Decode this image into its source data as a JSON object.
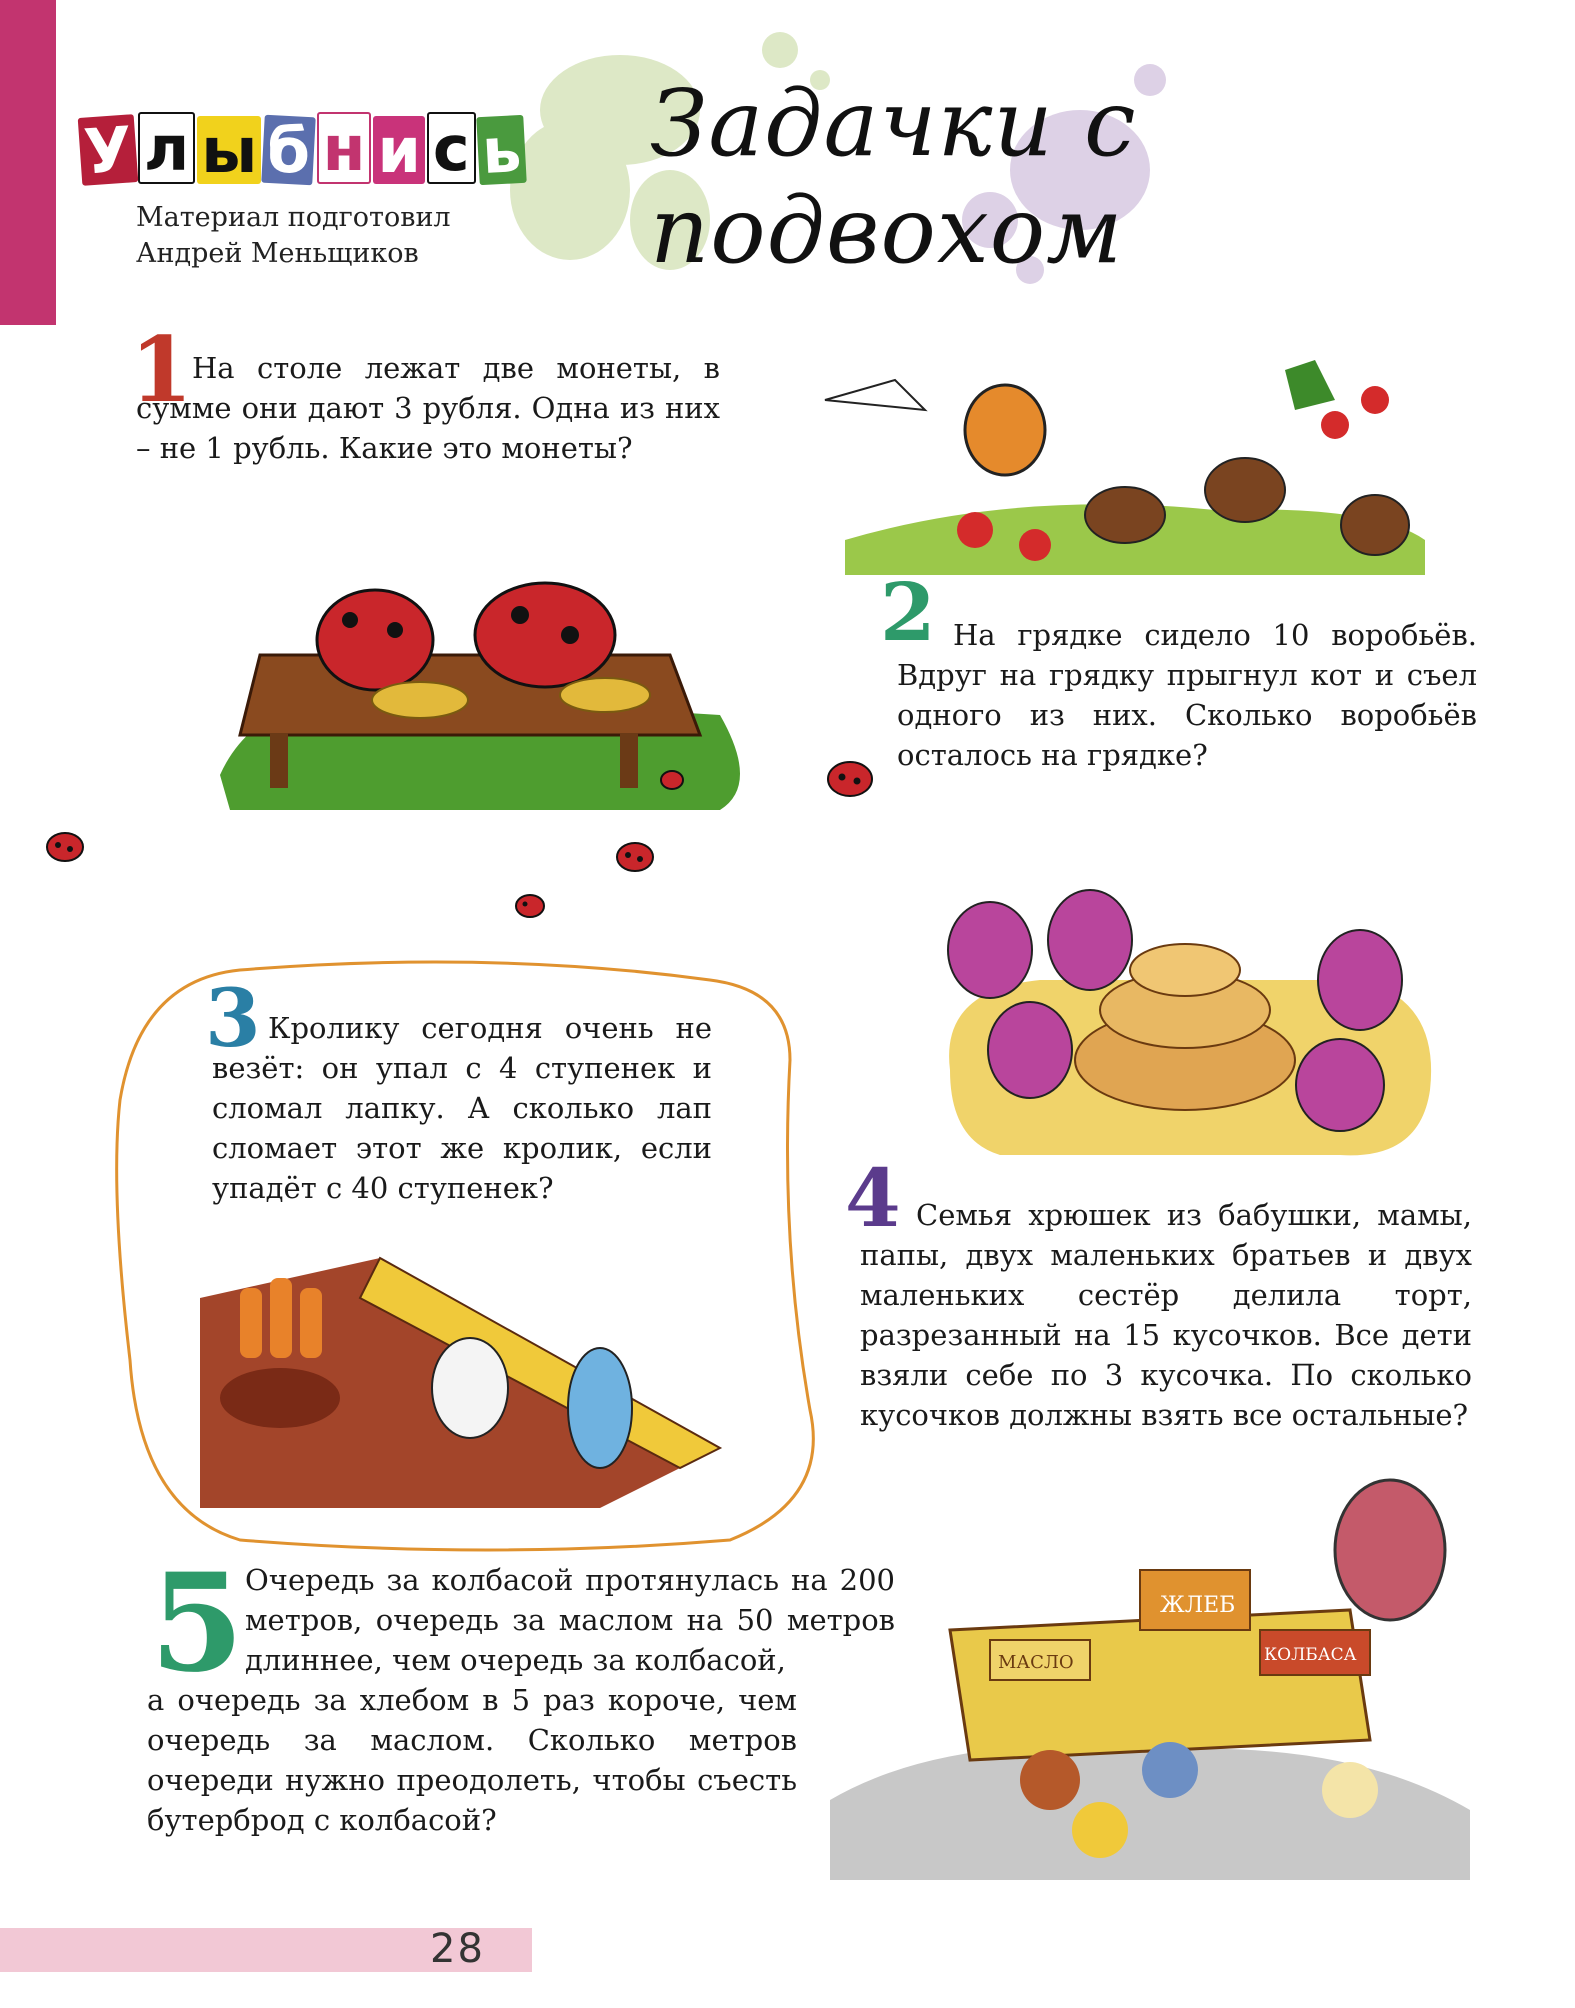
{
  "header": {
    "section_logo": [
      "У",
      "л",
      "ы",
      "б",
      "н",
      "и",
      "с",
      "ь"
    ],
    "title": "Задачки с подвохом",
    "credit_line1": "Материал подготовил",
    "credit_line2": "Андрей Меньщиков"
  },
  "problems": [
    {
      "number": "1",
      "text": "На столе лежат две монеты, в сумме они дают 3 рубля. Одна из них – не 1 рубль. Какие это монеты?"
    },
    {
      "number": "2",
      "text": "На грядке сидело 10 воробьёв. Вдруг на грядку прыгнул кот и съел одного из них. Сколько воробьёв осталось на грядке?"
    },
    {
      "number": "3",
      "text": "Кролику сегодня очень не везёт: он упал с 4 ступенек и сломал лапку. А сколько лап сломает этот же кролик, если упадёт с 40 ступенек?"
    },
    {
      "number": "4",
      "text": "Семья хрюшек из бабушки, мамы, папы, двух маленьких братьев и двух маленьких сестёр делила торт, разрезанный на 15 кусочков. Все дети взяли себе по 3 кусочка. По сколько кусочков должны взять все остальные?"
    },
    {
      "number": "5",
      "text_first": "Очередь за колбасой протянулась на 200 метров, очередь за маслом на 50 метров длиннее, чем очередь за колбасой,",
      "text_rest": "а очередь за хлебом в 5 раз короче, чем очередь за маслом. Сколько метров очереди нужно преодолеть, чтобы съесть бутерброд с колбасой?"
    }
  ],
  "illustrations": {
    "shop_signs": [
      "ЖЛЕБ",
      "КОЛБАСА",
      "МАСЛО"
    ]
  },
  "page_number": "28",
  "colors": {
    "sidebar": "#c2346f",
    "num1": "#c0392b",
    "num2": "#2e9a6a",
    "num3": "#2a7fa5",
    "num4": "#5b3b8c",
    "num5": "#2e9a6a",
    "outline3": "#e0922f",
    "folio_bar": "#f2c8d5"
  }
}
